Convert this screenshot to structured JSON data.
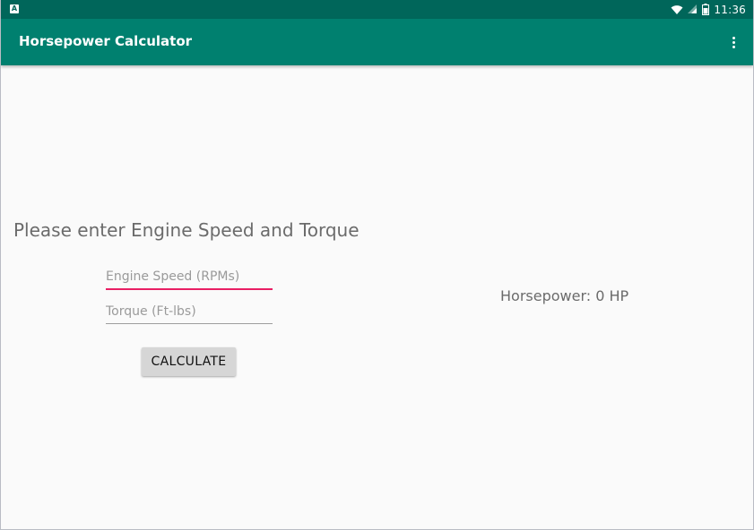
{
  "status_bar": {
    "time": "11:36",
    "notification_icon": "a-notification-icon",
    "icons": [
      "wifi-icon",
      "cell-signal-icon",
      "battery-icon"
    ]
  },
  "app_bar": {
    "title": "Horsepower Calculator",
    "menu_icon": "overflow-menu-icon"
  },
  "main": {
    "prompt": "Please enter Engine Speed and Torque",
    "engine_speed": {
      "placeholder": "Engine Speed (RPMs)",
      "value": ""
    },
    "torque": {
      "placeholder": "Torque (Ft-lbs)",
      "value": ""
    },
    "calculate_label": "CALCULATE",
    "result": "Horsepower: 0 HP"
  },
  "colors": {
    "status_bar": "#00665a",
    "app_bar": "#00806f",
    "accent": "#e91e63",
    "background": "#fafafa"
  }
}
